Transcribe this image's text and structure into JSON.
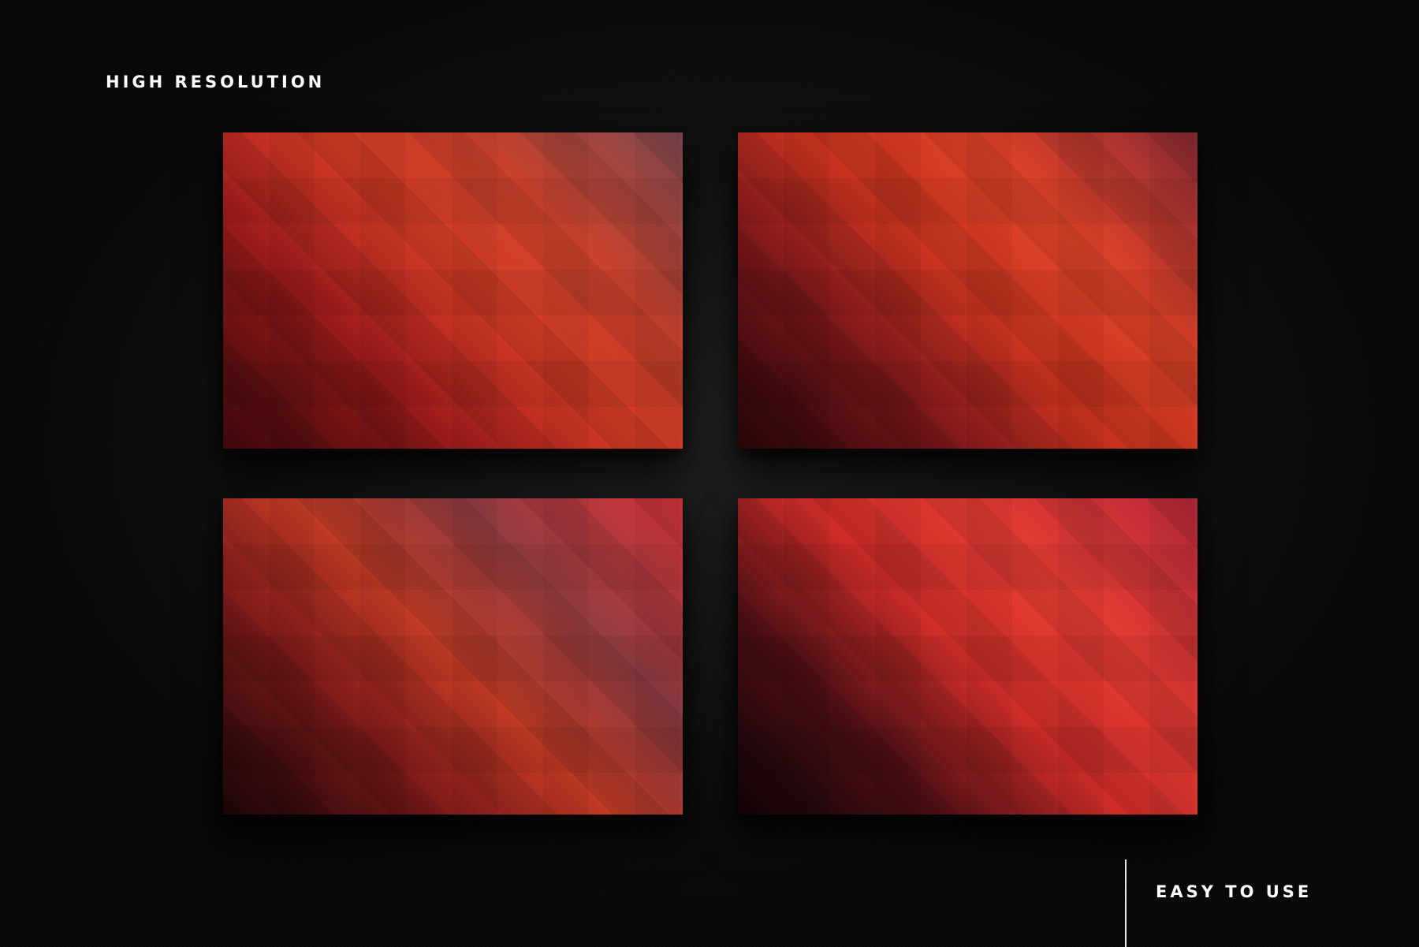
{
  "labels": {
    "top": "HIGH RESOLUTION",
    "bottom": "EASY TO USE"
  },
  "colors": {
    "background": "#141414",
    "text": "#ffffff",
    "accent_red": "#d23b25"
  },
  "cards": [
    {
      "id": "gradient-preview-1"
    },
    {
      "id": "gradient-preview-2"
    },
    {
      "id": "gradient-preview-3"
    },
    {
      "id": "gradient-preview-4"
    }
  ]
}
